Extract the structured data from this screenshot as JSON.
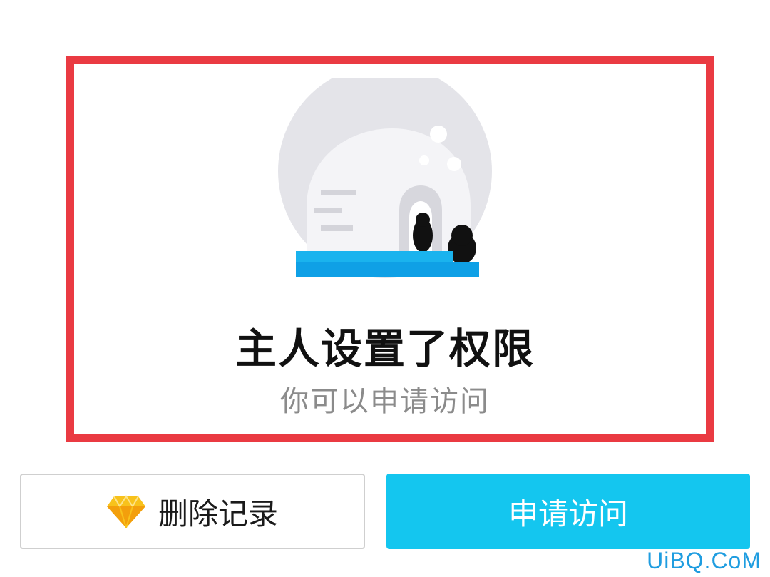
{
  "permission_notice": {
    "title": "主人设置了权限",
    "subtitle": "你可以申请访问"
  },
  "actions": {
    "delete_label": "删除记录",
    "apply_label": "申请访问"
  },
  "watermark": "UiBQ.CoM",
  "icons": {
    "delete": "diamond-icon",
    "illustration": "igloo-penguins-illustration"
  },
  "colors": {
    "highlight_border": "#ea3a42",
    "apply_button": "#14c6ef",
    "title_text": "#111111",
    "subtitle_text": "#8b8b8b"
  }
}
